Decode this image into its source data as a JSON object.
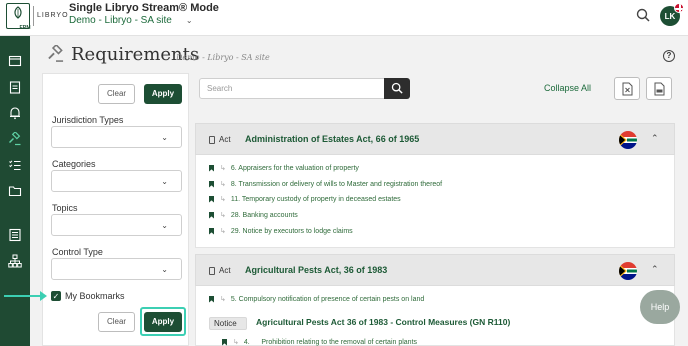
{
  "header": {
    "logo_erm": "ERM",
    "logo_libryo": "LIBRYO",
    "app_title": "Single Libryo Stream® Mode",
    "site_name": "Demo - Libryo - SA site",
    "avatar_initials": "LK"
  },
  "sidebar": {
    "icons": [
      "window-icon",
      "clipboard-icon",
      "bell-icon",
      "gavel-icon",
      "checklist-icon",
      "folder-icon",
      "document-list-icon",
      "org-chart-icon"
    ],
    "active": "gavel-icon"
  },
  "page": {
    "title": "Requirements",
    "subtitle": "Demo - Libryo - SA site"
  },
  "filters": {
    "clear_label": "Clear",
    "apply_label": "Apply",
    "jurisdiction_label": "Jurisdiction Types",
    "categories_label": "Categories",
    "topics_label": "Topics",
    "control_type_label": "Control Type",
    "bookmarks_label": "My Bookmarks",
    "bookmarks_checked": true
  },
  "toolbar": {
    "search_placeholder": "Search",
    "collapse_all": "Collapse All"
  },
  "acts": [
    {
      "type": "Act",
      "title": "Administration of Estates Act, 66 of 1965",
      "items": [
        "6. Appraisers for the valuation of property",
        "8. Transmission or delivery of wills to Master and registration thereof",
        "11. Temporary custody of property in deceased estates",
        "28. Banking accounts",
        "29. Notice by executors to lodge claims"
      ]
    },
    {
      "type": "Act",
      "title": "Agricultural Pests Act, 36 of 1983",
      "items": [
        "5. Compulsory notification of presence of certain pests on land"
      ],
      "notice": {
        "type": "Notice",
        "title": "Agricultural Pests Act 36 of 1983 - Control Measures (GN R110)",
        "items": [
          "4.      Prohibition relating to the removal of certain plants"
        ]
      }
    }
  ],
  "help_label": "Help",
  "colors": {
    "brand_green": "#1d4e34",
    "link_green": "#1d6b3c",
    "highlight": "#3ccfb3"
  }
}
